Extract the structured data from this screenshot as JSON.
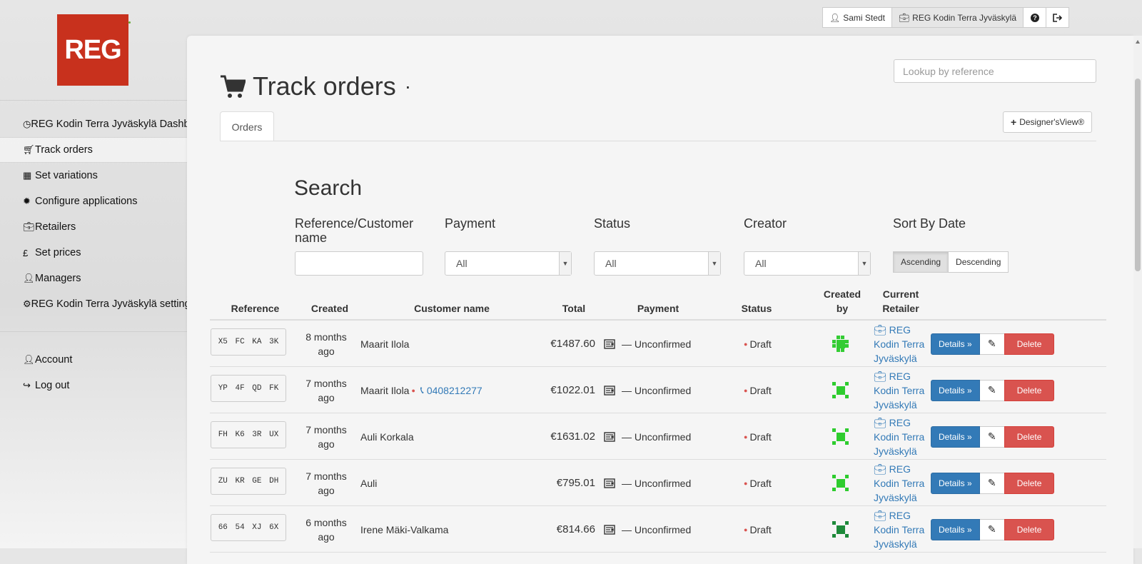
{
  "topbar": {
    "user": "Sami Stedt",
    "retailer": "REG Kodin Terra Jyväskylä",
    "help_icon": "question-circle-icon",
    "logout_icon": "logout-icon"
  },
  "logo": {
    "text": "REG",
    "color": "#c8311d"
  },
  "sidebar": {
    "items": [
      {
        "label": "REG Kodin Terra Jyväskylä Dashboard",
        "icon": "dashboard-icon",
        "active": false
      },
      {
        "label": "Track orders",
        "icon": "cart-icon",
        "active": true
      },
      {
        "label": "Set variations",
        "icon": "grid-icon",
        "active": false
      },
      {
        "label": "Configure applications",
        "icon": "cog-burst-icon",
        "active": false
      },
      {
        "label": "Retailers",
        "icon": "briefcase-icon",
        "active": false
      },
      {
        "label": "Set prices",
        "icon": "pound-icon",
        "active": false
      },
      {
        "label": "Managers",
        "icon": "user-icon",
        "active": false
      },
      {
        "label": "REG Kodin Terra Jyväskylä settings",
        "icon": "gear-icon",
        "active": false
      }
    ],
    "account_items": [
      {
        "label": "Account",
        "icon": "user-icon"
      },
      {
        "label": "Log out",
        "icon": "logout-icon"
      }
    ]
  },
  "page": {
    "title": "Track orders",
    "title_suffix": "·",
    "lookup_placeholder": "Lookup by reference",
    "tab_orders": "Orders",
    "designer_button": "Designer'sView®"
  },
  "search": {
    "title": "Search",
    "ref_label": "Reference/Customer name",
    "ref_value": "",
    "payment_label": "Payment",
    "payment_value": "All",
    "status_label": "Status",
    "status_value": "All",
    "creator_label": "Creator",
    "creator_value": "All",
    "sort_label": "Sort By Date",
    "sort_asc": "Ascending",
    "sort_desc": "Descending"
  },
  "table": {
    "headers": {
      "reference": "Reference",
      "created": "Created",
      "customer": "Customer name",
      "total": "Total",
      "payment": "Payment",
      "status": "Status",
      "created_by": "Created by",
      "retailer": "Current Retailer"
    },
    "rows": [
      {
        "ref": "X5 FC KA 3K",
        "created": "8 months ago",
        "customer": "Maarit Ilola",
        "phone": "",
        "total": "€1487.60",
        "payment": "— Unconfirmed",
        "status": "Draft",
        "retailer": "REG Kodin Terra Jyväskylä",
        "avatar_color": "#33cc33"
      },
      {
        "ref": "YP 4F QD FK",
        "created": "7 months ago",
        "customer": "Maarit Ilola",
        "phone": "0408212277",
        "total": "€1022.01",
        "payment": "— Unconfirmed",
        "status": "Draft",
        "retailer": "REG Kodin Terra Jyväskylä",
        "avatar_color": "#2ecc2e"
      },
      {
        "ref": "FH K6 3R UX",
        "created": "7 months ago",
        "customer": "Auli Korkala",
        "phone": "",
        "total": "€1631.02",
        "payment": "— Unconfirmed",
        "status": "Draft",
        "retailer": "REG Kodin Terra Jyväskylä",
        "avatar_color": "#2ecc2e"
      },
      {
        "ref": "ZU KR GE DH",
        "created": "7 months ago",
        "customer": "Auli",
        "phone": "",
        "total": "€795.01",
        "payment": "— Unconfirmed",
        "status": "Draft",
        "retailer": "REG Kodin Terra Jyväskylä",
        "avatar_color": "#2ecc2e"
      },
      {
        "ref": "66 54 XJ 6X",
        "created": "6 months ago",
        "customer": "Irene Mäki-Valkama",
        "phone": "",
        "total": "€814.66",
        "payment": "— Unconfirmed",
        "status": "Draft",
        "retailer": "REG Kodin Terra Jyväskylä",
        "avatar_color": "#1e8a3a"
      }
    ],
    "details_label": "Details »",
    "delete_label": "Delete"
  }
}
